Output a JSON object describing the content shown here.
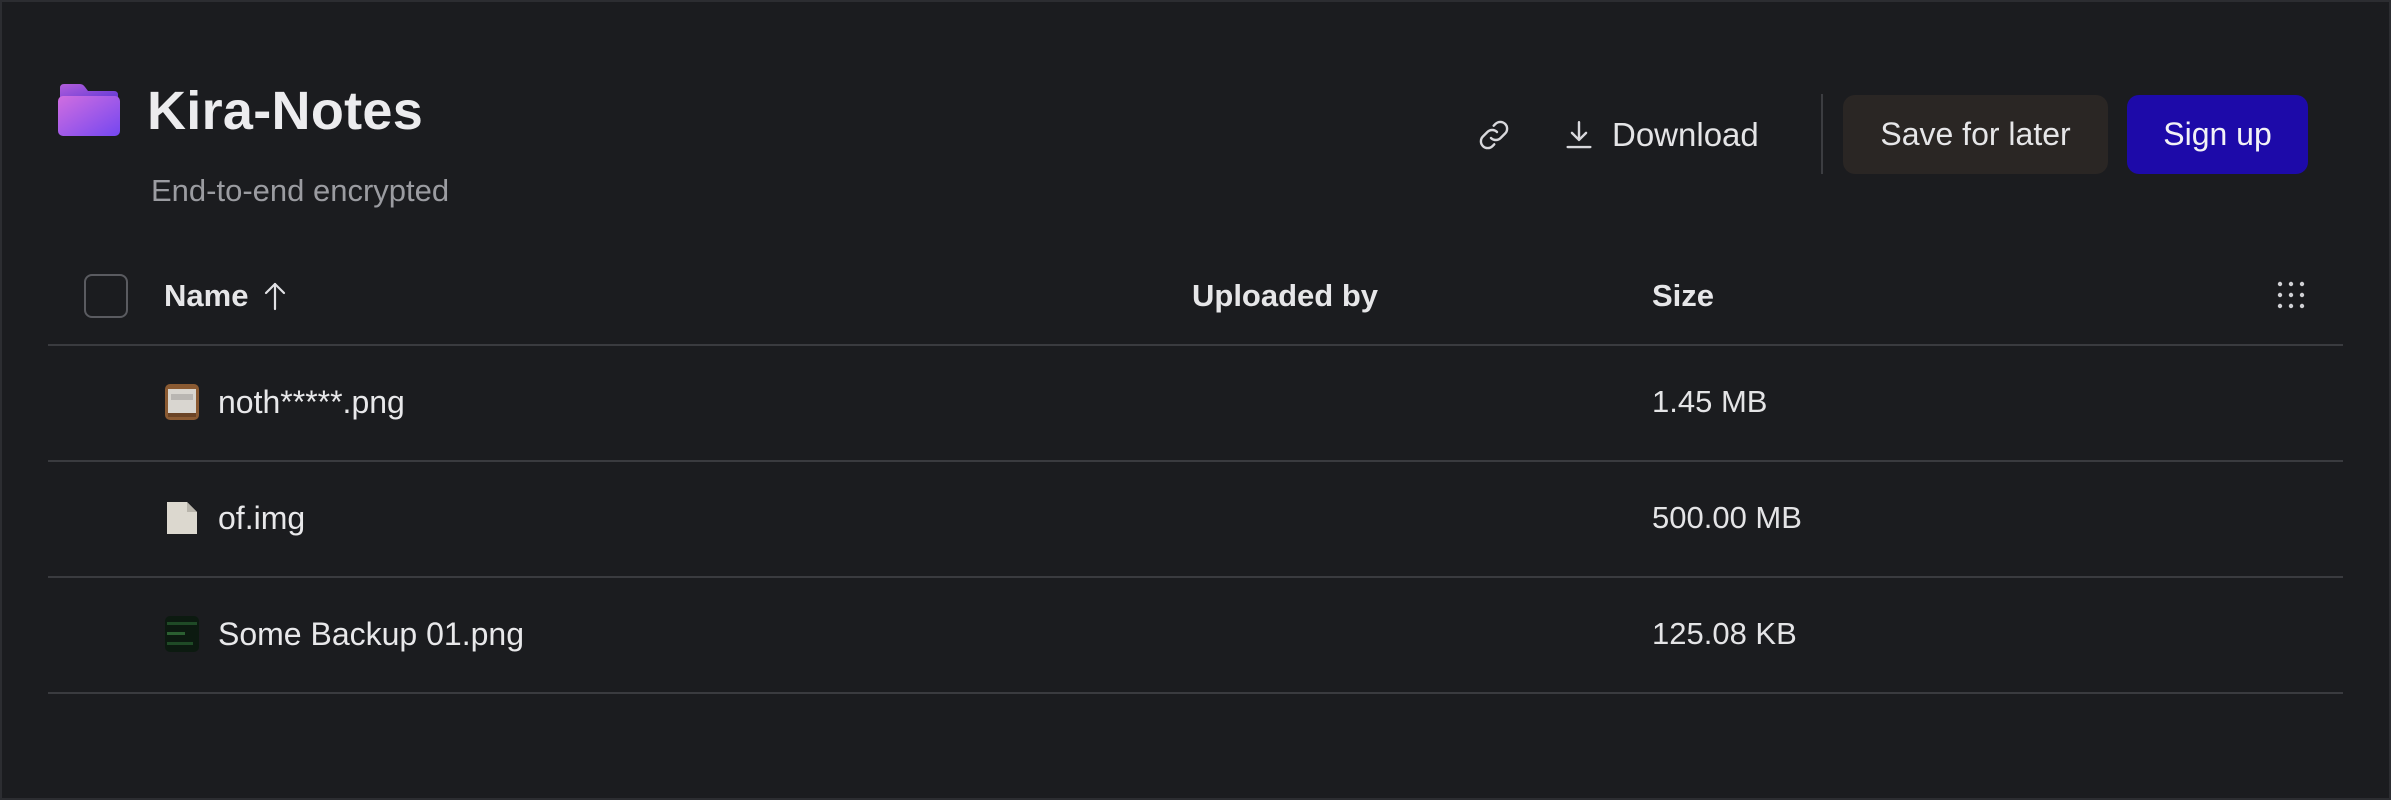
{
  "header": {
    "title": "Kira-Notes",
    "subtitle": "End-to-end encrypted",
    "folder_icon": "folder-icon",
    "accent_gradient": [
      "#c86dd7",
      "#7a4df2"
    ]
  },
  "actions": {
    "copy_link_icon": "link-icon",
    "download_label": "Download",
    "download_icon": "download-icon",
    "save_label": "Save for later",
    "signup_label": "Sign up",
    "signup_color": "#1d0aa9"
  },
  "table": {
    "columns": {
      "name": "Name",
      "uploaded_by": "Uploaded by",
      "size": "Size"
    },
    "sort": {
      "column": "name",
      "direction": "ascending"
    },
    "rows": [
      {
        "name": "noth*****.png",
        "uploaded_by": "",
        "size": "1.45 MB",
        "thumb": "image-thumbnail"
      },
      {
        "name": "of.img",
        "uploaded_by": "",
        "size": "500.00 MB",
        "thumb": "file-icon"
      },
      {
        "name": "Some Backup 01.png",
        "uploaded_by": "",
        "size": "125.08 KB",
        "thumb": "image-thumbnail"
      }
    ]
  }
}
